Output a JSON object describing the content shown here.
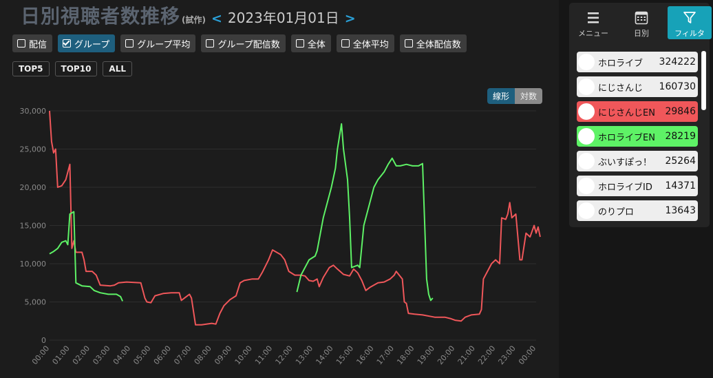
{
  "header": {
    "title": "日別視聴者数推移",
    "subtitle": "(試作)",
    "prev_arrow": "<",
    "next_arrow": ">",
    "date": "2023年01月01日"
  },
  "filter_buttons": [
    {
      "label": "配信",
      "checked": false
    },
    {
      "label": "グループ",
      "checked": true
    },
    {
      "label": "グループ平均",
      "checked": false
    },
    {
      "label": "グループ配信数",
      "checked": false
    },
    {
      "label": "全体",
      "checked": false
    },
    {
      "label": "全体平均",
      "checked": false
    },
    {
      "label": "全体配信数",
      "checked": false
    }
  ],
  "top_buttons": [
    "TOP5",
    "TOP10",
    "ALL"
  ],
  "scale_toggle": {
    "linear": "線形",
    "log": "対数",
    "selected": "linear"
  },
  "side_menu": {
    "items": [
      {
        "label": "メニュー",
        "icon": "menu-icon"
      },
      {
        "label": "日別",
        "icon": "calendar-icon"
      },
      {
        "label": "フィルタ",
        "icon": "filter-icon",
        "active": true
      }
    ]
  },
  "group_list": [
    {
      "name": "ホロライブ",
      "value": "324222",
      "bg": "#eeeeee"
    },
    {
      "name": "にじさんじ",
      "value": "160730",
      "bg": "#eeeeee"
    },
    {
      "name": "にじさんじEN",
      "value": "29846",
      "bg": "#f0575a"
    },
    {
      "name": "ホロライブEN",
      "value": "28219",
      "bg": "#5ef266"
    },
    {
      "name": "ぶいすぽっ！",
      "value": "25264",
      "bg": "#eeeeee"
    },
    {
      "name": "ホロライブID",
      "value": "14371",
      "bg": "#eeeeee"
    },
    {
      "name": "のりプロ",
      "value": "13643",
      "bg": "#eeeeee"
    }
  ],
  "colors": {
    "red_series": "#f0575a",
    "green_series": "#5ef266",
    "accent": "#17a2b8"
  },
  "chart_data": {
    "type": "line",
    "ylim": [
      0,
      30000
    ],
    "y_ticks": [
      "0",
      "5,000",
      "10,000",
      "15,000",
      "20,000",
      "25,000",
      "30,000"
    ],
    "x_ticks": [
      "00:00",
      "01:00",
      "02:00",
      "03:00",
      "04:00",
      "05:00",
      "06:00",
      "07:00",
      "08:00",
      "09:00",
      "10:00",
      "11:00",
      "12:00",
      "13:00",
      "14:00",
      "15:00",
      "16:00",
      "17:00",
      "18:00",
      "19:00",
      "20:00",
      "21:00",
      "22:00",
      "23:00",
      "00:00"
    ],
    "grid": true,
    "series": [
      {
        "color": "#f0575a",
        "points": [
          [
            0.0,
            30000
          ],
          [
            0.1,
            26000
          ],
          [
            0.2,
            24500
          ],
          [
            0.3,
            25000
          ],
          [
            0.4,
            20000
          ],
          [
            0.6,
            20200
          ],
          [
            0.8,
            21000
          ],
          [
            1.0,
            23000
          ],
          [
            1.1,
            12000
          ],
          [
            1.2,
            13000
          ],
          [
            1.3,
            11500
          ],
          [
            1.6,
            11500
          ],
          [
            1.7,
            10500
          ],
          [
            1.8,
            9000
          ],
          [
            2.1,
            9000
          ],
          [
            2.3,
            8500
          ],
          [
            2.5,
            7200
          ],
          [
            3.0,
            7100
          ],
          [
            3.2,
            7200
          ],
          [
            3.4,
            7500
          ],
          [
            3.8,
            7600
          ],
          [
            4.5,
            7500
          ],
          [
            4.7,
            5500
          ],
          [
            4.8,
            5000
          ],
          [
            5.0,
            4900
          ],
          [
            5.2,
            5800
          ],
          [
            5.6,
            6100
          ],
          [
            6.0,
            6200
          ],
          [
            6.4,
            6200
          ],
          [
            6.5,
            5200
          ],
          [
            6.7,
            5600
          ],
          [
            6.9,
            6000
          ],
          [
            7.0,
            5500
          ],
          [
            7.2,
            2000
          ],
          [
            7.5,
            2000
          ],
          [
            8.0,
            2200
          ],
          [
            8.2,
            2100
          ],
          [
            8.4,
            3500
          ],
          [
            8.6,
            4500
          ],
          [
            8.9,
            5300
          ],
          [
            9.2,
            5800
          ],
          [
            9.4,
            7500
          ],
          [
            9.6,
            7800
          ],
          [
            10.0,
            8000
          ],
          [
            10.3,
            8000
          ],
          [
            10.5,
            8900
          ],
          [
            10.8,
            10500
          ],
          [
            11.0,
            11800
          ],
          [
            11.4,
            11200
          ],
          [
            11.6,
            10500
          ],
          [
            11.8,
            9000
          ],
          [
            12.1,
            8500
          ],
          [
            12.4,
            8500
          ],
          [
            12.6,
            8400
          ],
          [
            12.8,
            7800
          ],
          [
            13.0,
            7700
          ],
          [
            13.2,
            8000
          ],
          [
            13.3,
            7000
          ],
          [
            13.5,
            8200
          ],
          [
            13.8,
            9500
          ],
          [
            14.0,
            9800
          ],
          [
            14.2,
            9300
          ],
          [
            14.5,
            8600
          ],
          [
            14.8,
            8400
          ],
          [
            15.0,
            9300
          ],
          [
            15.2,
            8800
          ],
          [
            15.4,
            7800
          ],
          [
            15.6,
            6500
          ],
          [
            15.8,
            6900
          ],
          [
            16.2,
            7500
          ],
          [
            16.5,
            7600
          ],
          [
            16.8,
            8000
          ],
          [
            17.0,
            8500
          ],
          [
            17.1,
            9000
          ],
          [
            17.4,
            8000
          ],
          [
            17.5,
            5000
          ],
          [
            17.6,
            4800
          ],
          [
            17.7,
            3500
          ],
          [
            18.0,
            3400
          ],
          [
            18.4,
            3300
          ],
          [
            19.0,
            3000
          ],
          [
            19.5,
            3000
          ],
          [
            19.8,
            2800
          ],
          [
            20.0,
            2600
          ],
          [
            20.3,
            2500
          ],
          [
            20.5,
            3000
          ],
          [
            20.8,
            3300
          ],
          [
            21.2,
            3400
          ],
          [
            21.3,
            4000
          ],
          [
            21.4,
            8000
          ],
          [
            21.6,
            9000
          ],
          [
            21.8,
            10000
          ],
          [
            22.0,
            10500
          ],
          [
            22.2,
            10000
          ],
          [
            22.3,
            16000
          ],
          [
            22.5,
            15800
          ],
          [
            22.6,
            16500
          ],
          [
            22.7,
            18000
          ],
          [
            22.8,
            16000
          ],
          [
            23.0,
            16500
          ],
          [
            23.2,
            10500
          ],
          [
            23.3,
            10500
          ],
          [
            23.5,
            14000
          ],
          [
            23.7,
            13500
          ],
          [
            23.9,
            15000
          ],
          [
            24.0,
            14000
          ],
          [
            24.1,
            14800
          ],
          [
            24.2,
            13500
          ]
        ]
      },
      {
        "color": "#5ef266",
        "points": [
          [
            0.0,
            11300
          ],
          [
            0.2,
            11600
          ],
          [
            0.4,
            12000
          ],
          [
            0.6,
            12800
          ],
          [
            0.8,
            13000
          ],
          [
            0.9,
            12500
          ],
          [
            1.0,
            16500
          ],
          [
            1.2,
            16800
          ],
          [
            1.3,
            7500
          ],
          [
            1.6,
            7100
          ],
          [
            2.0,
            7000
          ],
          [
            2.2,
            6500
          ],
          [
            2.5,
            6200
          ],
          [
            2.9,
            6000
          ],
          [
            3.3,
            6000
          ],
          [
            3.5,
            5700
          ],
          [
            3.6,
            5100
          ],
          null,
          [
            12.2,
            6300
          ],
          [
            12.4,
            8500
          ],
          [
            12.8,
            10500
          ],
          [
            13.1,
            11000
          ],
          [
            13.2,
            11700
          ],
          [
            13.5,
            16000
          ],
          [
            13.7,
            18000
          ],
          [
            13.9,
            20000
          ],
          [
            14.1,
            22500
          ],
          [
            14.2,
            25000
          ],
          [
            14.4,
            28300
          ],
          [
            14.5,
            25000
          ],
          [
            14.7,
            21000
          ],
          [
            14.8,
            16000
          ],
          [
            14.9,
            9500
          ],
          [
            15.2,
            9800
          ],
          [
            15.3,
            9500
          ],
          [
            15.5,
            15000
          ],
          [
            15.8,
            18000
          ],
          [
            16.0,
            20000
          ],
          [
            16.2,
            21000
          ],
          [
            16.5,
            22000
          ],
          [
            16.7,
            23000
          ],
          [
            16.9,
            23800
          ],
          [
            17.1,
            22800
          ],
          [
            17.3,
            22800
          ],
          [
            17.6,
            23000
          ],
          [
            17.9,
            22800
          ],
          [
            18.2,
            22800
          ],
          [
            18.4,
            23100
          ],
          [
            18.6,
            8000
          ],
          [
            18.7,
            6000
          ],
          [
            18.8,
            5200
          ],
          [
            18.9,
            5500
          ]
        ]
      }
    ]
  }
}
